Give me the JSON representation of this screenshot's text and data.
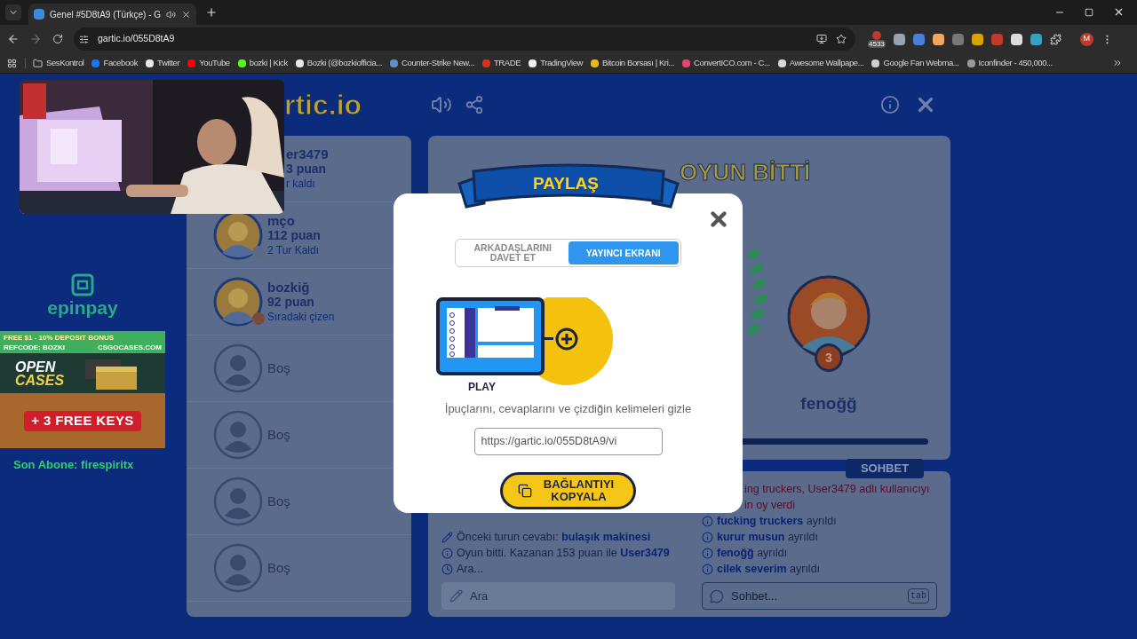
{
  "browser": {
    "tab": {
      "title": "Genel #5D8tA9 (Türkçe) - G",
      "selected": true
    },
    "address": "gartic.io/055D8tA9",
    "extension_badge": "4533",
    "profile_initial": "M",
    "bookmarks": [
      {
        "label": "SesKontrol",
        "kind": "folder"
      },
      {
        "label": "Facebook",
        "kind": "site",
        "color": "#1877f2"
      },
      {
        "label": "Twitter",
        "kind": "site",
        "color": "#e8e8e8"
      },
      {
        "label": "YouTube",
        "kind": "site",
        "color": "#ff0000"
      },
      {
        "label": "bozki | Kick",
        "kind": "site",
        "color": "#53fc18"
      },
      {
        "label": "Bozki (@bozkiofficia...",
        "kind": "site",
        "color": "#e8e8e8"
      },
      {
        "label": "Counter-Strike New...",
        "kind": "site",
        "color": "#5b8fd0"
      },
      {
        "label": "TRADE",
        "kind": "site",
        "color": "#d93025"
      },
      {
        "label": "TradingView",
        "kind": "site",
        "color": "#f2f2f2"
      },
      {
        "label": "Bitcoin Borsası | Kri...",
        "kind": "site",
        "color": "#f0b90b"
      },
      {
        "label": "ConvertICO.com - C...",
        "kind": "site",
        "color": "#e8436a"
      },
      {
        "label": "Awesome Wallpape...",
        "kind": "site",
        "color": "#d8d8d8"
      },
      {
        "label": "Google Fan Webma...",
        "kind": "site",
        "color": "#cfcfcf"
      },
      {
        "label": "Iconfinder - 450,000...",
        "kind": "site",
        "color": "#9a9a9a"
      }
    ]
  },
  "stream_overlay": {
    "sponsor": "epinpay",
    "banner": {
      "top_line": "FREE $1 - 10% DEPOSIT BONUS",
      "refcode": "REFCODE: BOZKI",
      "site": "CSGOCASES.COM",
      "headline_1": "OPEN",
      "headline_2": "CASES",
      "offer": "+ 3 FREE KEYS"
    },
    "last_subscriber": "Son Abone: firespiritx"
  },
  "game": {
    "logo": "rtic.io",
    "players": [
      {
        "kind": "covered",
        "name": "er3479",
        "score": "3 puan",
        "status": "r kaldı"
      },
      {
        "kind": "player",
        "name": "mço",
        "score": "112 puan",
        "status": "2 Tur Kaldı",
        "color": "#5b6a82"
      },
      {
        "kind": "player",
        "name": "bozkiğ",
        "score": "92 puan",
        "status": "Sıradaki çizen",
        "color": "#7b4a3c"
      },
      {
        "kind": "empty",
        "name": "Boş"
      },
      {
        "kind": "empty",
        "name": "Boş"
      },
      {
        "kind": "empty",
        "name": "Boş"
      },
      {
        "kind": "empty",
        "name": "Boş"
      }
    ],
    "result": {
      "title": "OYUN BİTTİ",
      "winner": {
        "name": "fenoğğ",
        "rank": "3"
      }
    },
    "answers": {
      "lines": [
        {
          "kind": "pencil",
          "text": "Önceki turun cevabı: **bulaşık makinesi**"
        },
        {
          "kind": "info",
          "text": "Oyun bitti. Kazanan 153 puan ile **User3479**"
        },
        {
          "kind": "clock",
          "text": "Ara..."
        }
      ],
      "placeholder": "Ara"
    },
    "chat": {
      "title": "SOHBET",
      "lines": [
        {
          "kind": "vote",
          "text": "**ing truckers**, **User3479** adlı kullanıcıyı"
        },
        {
          "kind": "vote",
          "text": "in oy verdi"
        },
        {
          "kind": "info",
          "text": "**fucking truckers** ayrıldı"
        },
        {
          "kind": "info",
          "text": "**kurur musun** ayrıldı"
        },
        {
          "kind": "info",
          "text": "**fenoğğ** ayrıldı"
        },
        {
          "kind": "info",
          "text": "**cilek severim** ayrıldı"
        }
      ],
      "placeholder": "Sohbet...",
      "shortcut": "tab"
    }
  },
  "modal": {
    "title": "PAYLAŞ",
    "tabs": [
      {
        "label": "ARKADAŞLARINI DAVET ET",
        "selected": false
      },
      {
        "label": "YAYINCI EKRANI",
        "selected": true
      }
    ],
    "illustration_label": "PLAY",
    "description": "İpuçlarını, cevaplarını ve çizdiğin kelimeleri gizle",
    "link": "https://gartic.io/055D8tA9/vi",
    "copy_button": "BAĞLANTIYI KOPYALA"
  }
}
